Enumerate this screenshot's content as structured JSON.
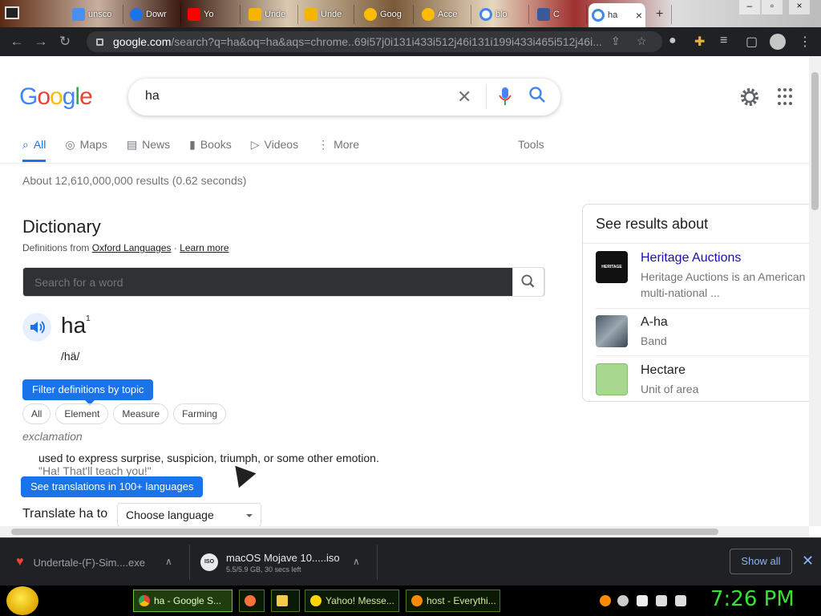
{
  "browser": {
    "tabs": [
      {
        "label": "unsco",
        "color": "#4a8ef0"
      },
      {
        "label": "Dowr",
        "color": "#1a73e8"
      },
      {
        "label": "Yo",
        "color": "#ff0000"
      },
      {
        "label": "Unde",
        "color": "#f4b400"
      },
      {
        "label": "Unde",
        "color": "#f4b400"
      },
      {
        "label": "Goog",
        "color": "#fbbc05"
      },
      {
        "label": "Acce",
        "color": "#fbbc05"
      },
      {
        "label": "blo",
        "color": "#4285f4"
      },
      {
        "label": "C",
        "color": "#3b5998"
      },
      {
        "label": "ha",
        "color": "#4285f4",
        "active": true
      }
    ],
    "url_host": "google.com",
    "url_rest": "/search?q=ha&oq=ha&aqs=chrome..69i57j0i131i433i512j46i131i199i433i465i512j46i..."
  },
  "search": {
    "logo": "Google",
    "query": "ha"
  },
  "navtabs": [
    {
      "label": "All",
      "icon": "search-icon",
      "active": true
    },
    {
      "label": "Maps",
      "icon": "map-pin-icon"
    },
    {
      "label": "News",
      "icon": "news-icon"
    },
    {
      "label": "Books",
      "icon": "book-icon"
    },
    {
      "label": "Videos",
      "icon": "play-icon"
    },
    {
      "label": "More",
      "icon": "dots-vertical-icon"
    }
  ],
  "tools_label": "Tools",
  "stats": "About 12,610,000,000 results (0.62 seconds)",
  "dictionary": {
    "title": "Dictionary",
    "source_prefix": "Definitions from",
    "source_link": "Oxford Languages",
    "source_sep": "·",
    "learn_more": "Learn more",
    "search_placeholder": "Search for a word",
    "word": "ha",
    "superscript": "1",
    "phonetic": "/hä/",
    "filter_tip": "Filter definitions by topic",
    "chips": [
      "All",
      "Element",
      "Measure",
      "Farming"
    ],
    "part_of_speech": "exclamation",
    "definition": "used to express surprise, suspicion, triumph, or some other emotion.",
    "example": "\"Ha! That'll teach you!\"",
    "translations_tip": "See translations in 100+ languages",
    "translate_label": "Translate ha to",
    "language_select": "Choose language"
  },
  "knowledge_panel": {
    "title": "See results about",
    "items": [
      {
        "name": "Heritage Auctions",
        "desc": "Heritage Auctions is an American multi-national ...",
        "thumb_text": "HERITAGE AUCTIONS"
      },
      {
        "name": "A-ha",
        "desc": "Band"
      },
      {
        "name": "Hectare",
        "desc": "Unit of area"
      }
    ]
  },
  "downloads": {
    "items": [
      {
        "name": "Undertale-(F)-Sim....exe",
        "meta": ""
      },
      {
        "name": "macOS Mojave 10.....iso",
        "meta": "5.5/5.9 GB, 30 secs left",
        "icon_text": "ISO"
      }
    ],
    "show_all": "Show all"
  },
  "taskbar": {
    "tasks": [
      {
        "label": "ha - Google S...",
        "active": true
      },
      {
        "label": ""
      },
      {
        "label": ""
      },
      {
        "label": "Yahoo! Messe..."
      },
      {
        "label": "host - Everythi..."
      }
    ],
    "clock": "7:26 PM"
  }
}
